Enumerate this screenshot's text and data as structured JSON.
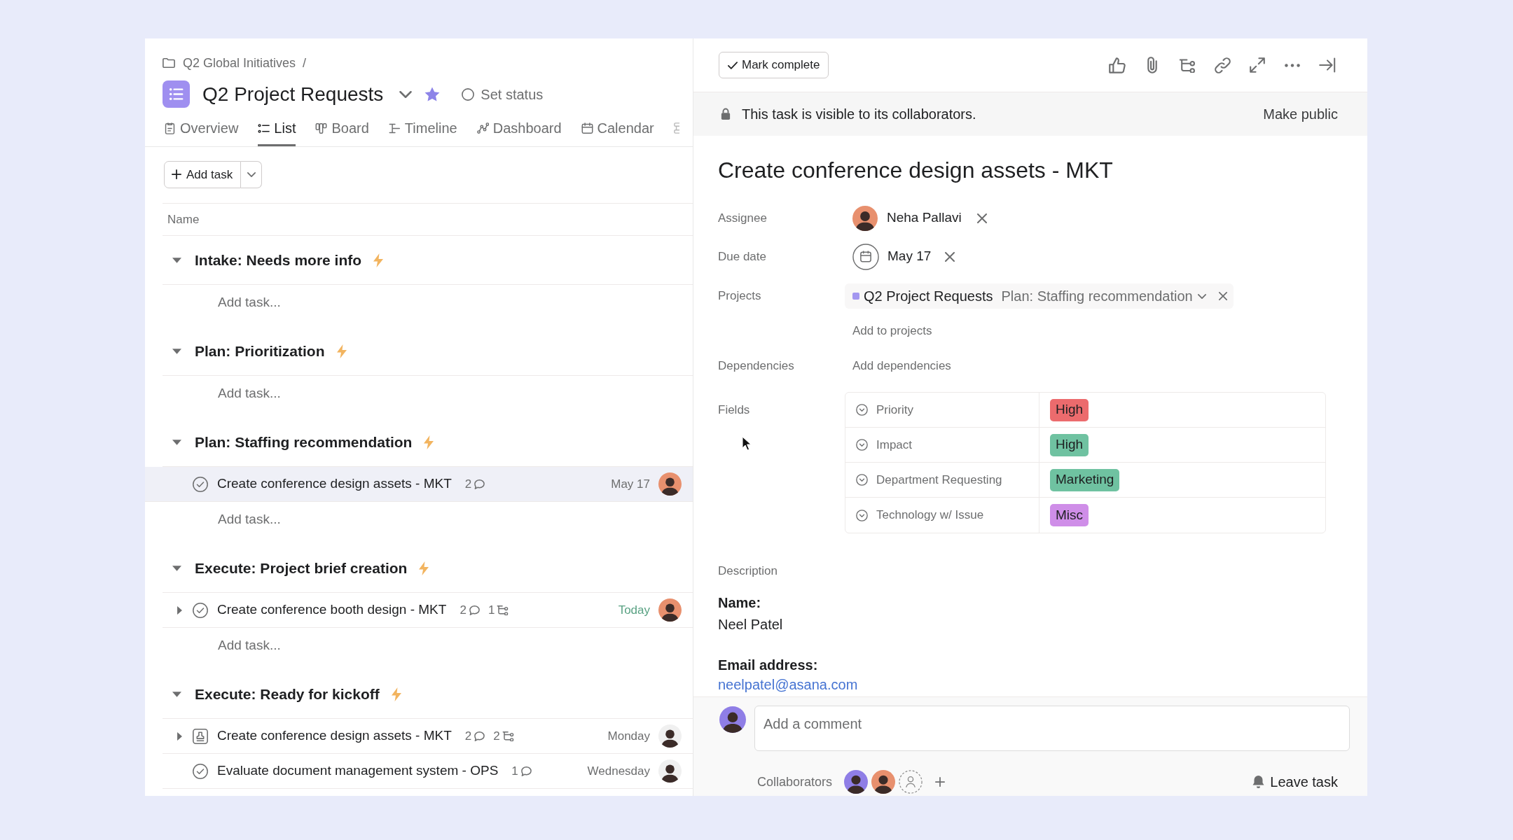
{
  "breadcrumb": {
    "text": "Q2 Global Initiatives",
    "separator": "/"
  },
  "project": {
    "title": "Q2 Project Requests",
    "starred": true,
    "status": "Set status"
  },
  "tabs": [
    {
      "label": "Overview",
      "selected": false
    },
    {
      "label": "List",
      "selected": true
    },
    {
      "label": "Board",
      "selected": false
    },
    {
      "label": "Timeline",
      "selected": false
    },
    {
      "label": "Dashboard",
      "selected": false
    },
    {
      "label": "Calendar",
      "selected": false
    }
  ],
  "add_task": "Add task",
  "list": {
    "column": "Name",
    "sections": [
      {
        "title": "Intake: Needs more info",
        "expanded": true,
        "add_task": "Add task..."
      },
      {
        "title": "Plan: Prioritization",
        "expanded": true,
        "add_task": "Add task..."
      },
      {
        "title": "Plan: Staffing recommendation",
        "expanded": true,
        "tasks": [
          {
            "kind": "task",
            "title": "Create conference design assets - MKT",
            "selected": true,
            "expandable": false,
            "comments": "2",
            "due": {
              "text": "May 17",
              "color": "#6d6e6f"
            },
            "avatar": {
              "color": "#e8906e"
            }
          }
        ],
        "add_task": "Add task..."
      },
      {
        "title": "Execute: Project brief creation",
        "expanded": true,
        "tasks": [
          {
            "kind": "task",
            "title": "Create conference booth design - MKT",
            "selected": false,
            "expandable": true,
            "comments": "2",
            "subtasks": "1",
            "due": {
              "text": "Today",
              "color": "#58a182"
            },
            "avatar": {
              "color": "#e8906e"
            }
          }
        ],
        "add_task": "Add task..."
      },
      {
        "title": "Execute: Ready for kickoff",
        "expanded": true,
        "tasks": [
          {
            "kind": "approval",
            "title": "Create conference design assets - MKT",
            "selected": false,
            "expandable": true,
            "comments": "2",
            "subtasks": "2",
            "due": {
              "text": "Monday",
              "color": "#6d6e6f"
            },
            "avatar": {
              "color": "#f0f0f0"
            }
          },
          {
            "kind": "task",
            "title": "Evaluate document management system - OPS",
            "selected": false,
            "expandable": false,
            "comments": "1",
            "due": {
              "text": "Wednesday",
              "color": "#6d6e6f"
            },
            "avatar": {
              "color": "#f0f0f0"
            }
          }
        ]
      }
    ]
  },
  "task_pane": {
    "mark_complete": "Mark complete",
    "visibility": {
      "text": "This task is visible to its collaborators.",
      "action": "Make public"
    },
    "title": "Create conference design assets - MKT",
    "assignee": {
      "label": "Assignee",
      "name": "Neha Pallavi",
      "avatar": {
        "color": "#e8906e"
      }
    },
    "due_date": {
      "label": "Due date",
      "value": "May 17"
    },
    "projects": {
      "label": "Projects",
      "items": [
        {
          "name": "Q2 Project Requests",
          "color": "#a397f0",
          "section": "Plan: Staffing recommendation"
        }
      ],
      "add": "Add to projects"
    },
    "dependencies": {
      "label": "Dependencies",
      "add": "Add dependencies"
    },
    "fields": {
      "label": "Fields",
      "rows": [
        {
          "name": "Priority",
          "value": "High",
          "color": "#ec6b6d"
        },
        {
          "name": "Impact",
          "value": "High",
          "color": "#6fc2a1"
        },
        {
          "name": "Department Requesting",
          "value": "Marketing",
          "color": "#6fc2a1"
        },
        {
          "name": "Technology w/ Issue",
          "value": "Misc",
          "color": "#cf8ee8"
        }
      ]
    },
    "description": {
      "label": "Description",
      "lines": [
        {
          "kind": "heading",
          "text": "Name:"
        },
        {
          "kind": "text",
          "text": "Neel Patel"
        },
        {
          "kind": "heading",
          "text": "Email address:"
        },
        {
          "kind": "link",
          "text": "neelpatel@asana.com"
        }
      ]
    },
    "comment": {
      "placeholder": "Add a comment",
      "avatar": {
        "color": "#8f7ee6"
      }
    },
    "collaborators": {
      "label": "Collaborators",
      "people": [
        {
          "color": "#8f7ee6"
        },
        {
          "color": "#e8906e"
        }
      ],
      "leave": "Leave task"
    }
  }
}
